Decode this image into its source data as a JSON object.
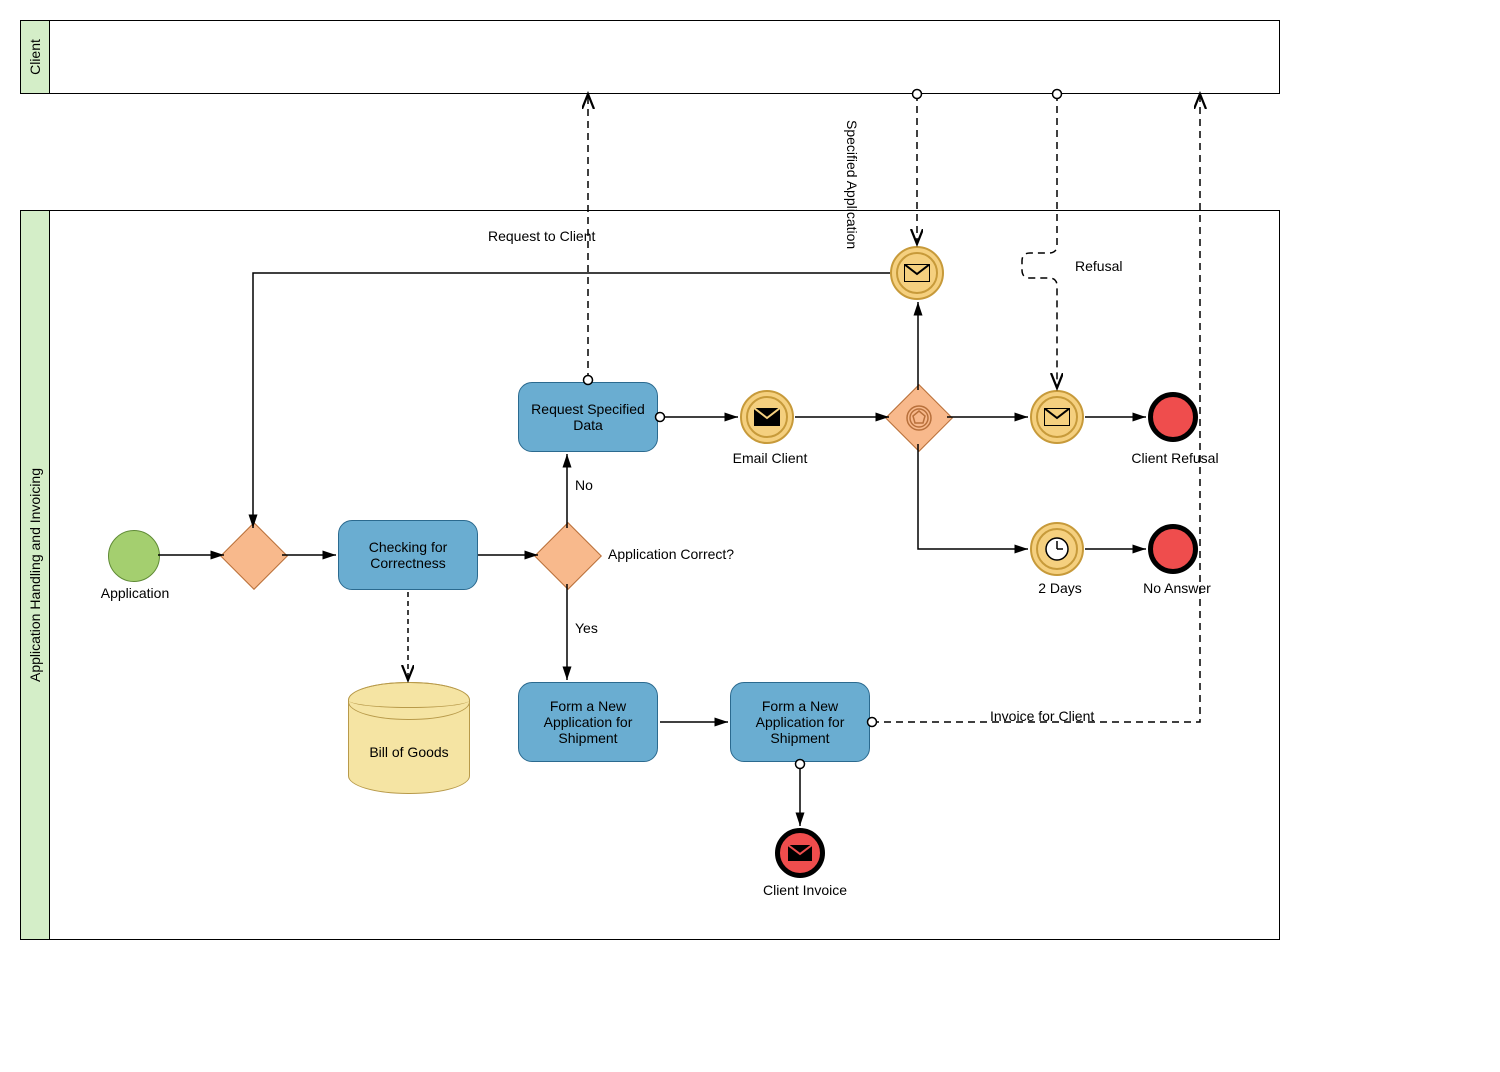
{
  "pools": {
    "client": "Client",
    "process": "Application Handling and Invoicing"
  },
  "events": {
    "start_label": "Application",
    "email_client_label": "Email Client",
    "two_days_label": "2 Days",
    "client_refusal_label": "Client Refusal",
    "no_answer_label": "No Answer",
    "client_invoice_label": "Client Invoice"
  },
  "tasks": {
    "checking": "Checking for Correctness",
    "request_data": "Request Specified Data",
    "form_shipment1": "Form a New Application for Shipment",
    "form_shipment2": "Form a New Application for Shipment"
  },
  "data": {
    "bill_of_goods": "Bill of Goods"
  },
  "gateways": {
    "app_correct": "Application Correct?"
  },
  "edges": {
    "no": "No",
    "yes": "Yes",
    "request_to_client": "Request to Client",
    "specified_application": "Specified Application",
    "refusal": "Refusal",
    "invoice_for_client": "Invoice for Client"
  }
}
